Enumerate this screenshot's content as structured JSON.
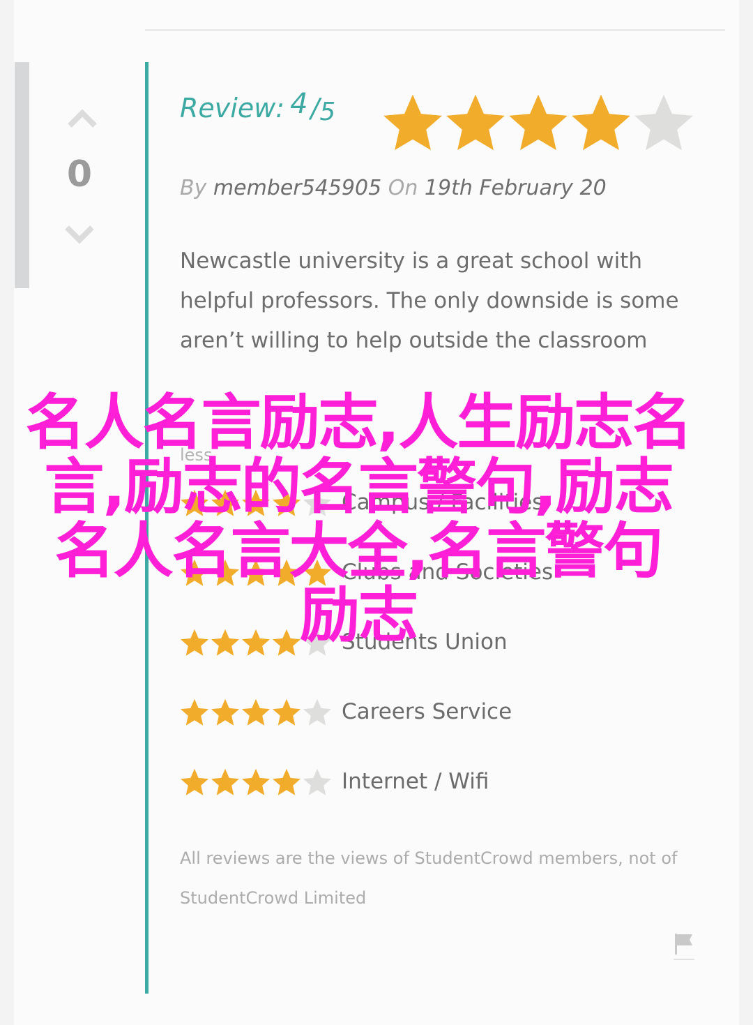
{
  "vote": {
    "count": "0"
  },
  "review": {
    "label": "Review:",
    "score": "4",
    "slash": "/",
    "max": "5",
    "rating_stars": 4,
    "by_word": "By",
    "author": "member545905",
    "on_word": "On",
    "date": "19th February 20",
    "body": "Newcastle university is a great school with helpful professors. The only downside is some aren’t willing to help outside the classroom",
    "less_link": "less"
  },
  "categories": [
    {
      "label": "Campus / Facilities",
      "stars": 4
    },
    {
      "label": "Clubs and Societies",
      "stars": 5
    },
    {
      "label": "Students Union",
      "stars": 4
    },
    {
      "label": "Careers Service",
      "stars": 4
    },
    {
      "label": "Internet / Wifi",
      "stars": 4
    }
  ],
  "disclaimer": "All reviews are the views of StudentCrowd members, not of StudentCrowd Limited",
  "overlay_text": "名人名言励志,人生励志名言,励志的名言警句,励志名人名言大全,名言警句 励志",
  "colors": {
    "accent_teal": "#3ca9a3",
    "star_filled": "#f1ac2b",
    "star_empty": "#dededc",
    "overlay_magenta": "#ff1fd6"
  },
  "icons": {
    "vote_up": "chevron-up-icon",
    "vote_down": "chevron-down-icon",
    "report": "flag-icon",
    "rating": "star-icon"
  }
}
